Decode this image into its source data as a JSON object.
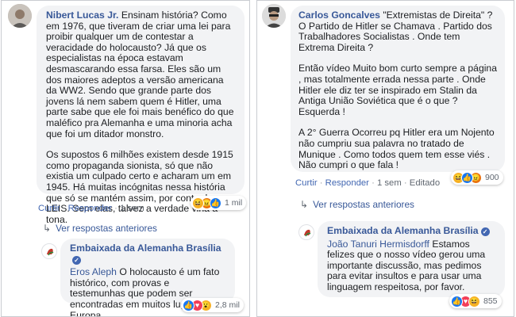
{
  "left": {
    "comment": {
      "author": "Nibert Lucas Jr.",
      "paragraph1": " Ensinam história? Como em 1976, que tiveram de criar uma lei para proibir qualquer um de contestar a veracidade do holocausto? Já que os especialistas na época estavam desmascarando essa farsa. Eles são um dos maiores adeptos a versão americana da WW2. Sendo que grande parte dos jovens lá nem sabem quem é Hitler, uma parte sabe que ele foi mais benéfico do que maléfico pra Alemanha e uma minoria acha que foi um ditador monstro.",
      "paragraph2": "Os supostos 6 milhões existem desde 1915 como propaganda sionista, só que não existia um culpado certo e acharam um em 1945. Há muitas incógnitas nessa história que só se mantém assim, por conta de LEIS. Sem elas, talvez a verdade viria a tona.",
      "reaction_count": "1 mil",
      "like_label": "Curtir",
      "reply_label": "Responder",
      "separator": "·",
      "time": "1 sem"
    },
    "more_replies": "Ver respostas anteriores",
    "reply": {
      "author": "Embaixada da Alemanha Brasília",
      "mention": "Eros Aleph",
      "text": " O holocausto é um fato histórico, com provas e testemunhas que podem ser encontradas em muitos lugares da Europa.",
      "reaction_count": "2,8 mil"
    }
  },
  "right": {
    "comment": {
      "author": "Carlos Goncalves",
      "line1": " \"Extremistas de Direita\" ? O Partido de Hitler se Chamava . Partido dos Trabalhadores Socialistas . Onde tem Extrema Direita ?",
      "paragraph2": "Então vídeo Muito bom curto sempre a página , mas totalmente errada nessa parte . Onde Hitler ele diz ter se inspirado em Stalin da Antiga União Soviética que é o que ? Esquerda !",
      "paragraph3": "A 2° Guerra Ocorreu pq Hitler era um Nojento não cumpriu sua palavra no tratado de Munique . Como todos quem tem esse viés . Não cumpri o que fala !",
      "reaction_count": "900",
      "like_label": "Curtir",
      "reply_label": "Responder",
      "separator": "·",
      "time": "1 sem",
      "edited": "Editado"
    },
    "more_replies": "Ver respostas anteriores",
    "reply": {
      "author": "Embaixada da Alemanha Brasília",
      "mention": "João Tanuri Hermisdorff",
      "text": " Estamos felizes que o nosso vídeo gerou uma importante discussão, mas pedimos para evitar insultos e para usar uma linguagem respeitosa, por favor.",
      "reaction_count": "855"
    }
  },
  "icons": {
    "reply_arrow": "reply-arrow-icon",
    "verified": "verified-badge-icon"
  },
  "colors": {
    "link": "#385898",
    "bubble": "#f2f3f5",
    "text": "#1c1e21",
    "meta": "#606770"
  }
}
